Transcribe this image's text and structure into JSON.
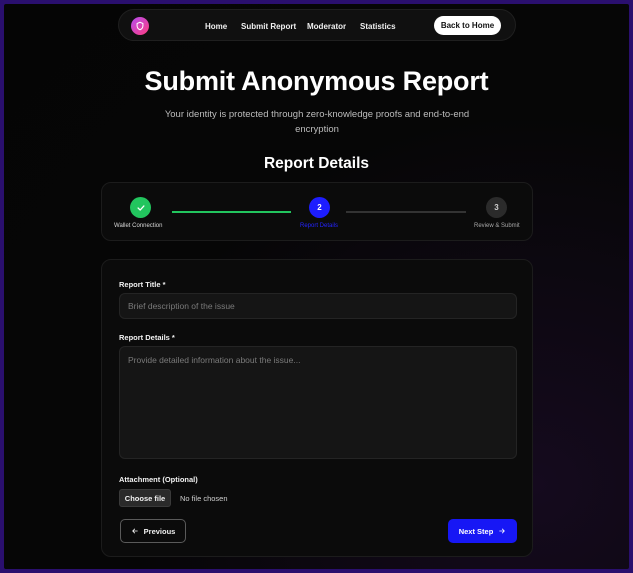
{
  "nav": {
    "logo_icon": "shield-icon",
    "links": [
      "Home",
      "Submit Report",
      "Moderator",
      "Statistics"
    ],
    "home_button": "Back to Home"
  },
  "hero": {
    "title": "Submit Anonymous Report",
    "subtitle": "Your identity is protected through zero-knowledge proofs and end-to-end encryption"
  },
  "section_title": "Report Details",
  "stepper": {
    "steps": [
      {
        "label": "Wallet Connection",
        "state": "complete",
        "icon": "check-icon"
      },
      {
        "label": "Report Details",
        "number": "2",
        "state": "active"
      },
      {
        "label": "Review & Submit",
        "number": "3",
        "state": "pending"
      }
    ],
    "colors": {
      "complete": "#22c55e",
      "active": "#1d1dff",
      "pending": "#2b2b2b"
    }
  },
  "form": {
    "title_label": "Report Title *",
    "title_placeholder": "Brief description of the issue",
    "details_label": "Report Details *",
    "details_placeholder": "Provide detailed information about the issue...",
    "attachment_label": "Attachment (Optional)",
    "file_button": "Choose file",
    "file_status": "No file chosen",
    "previous_button": "Previous",
    "next_button": "Next Step"
  }
}
